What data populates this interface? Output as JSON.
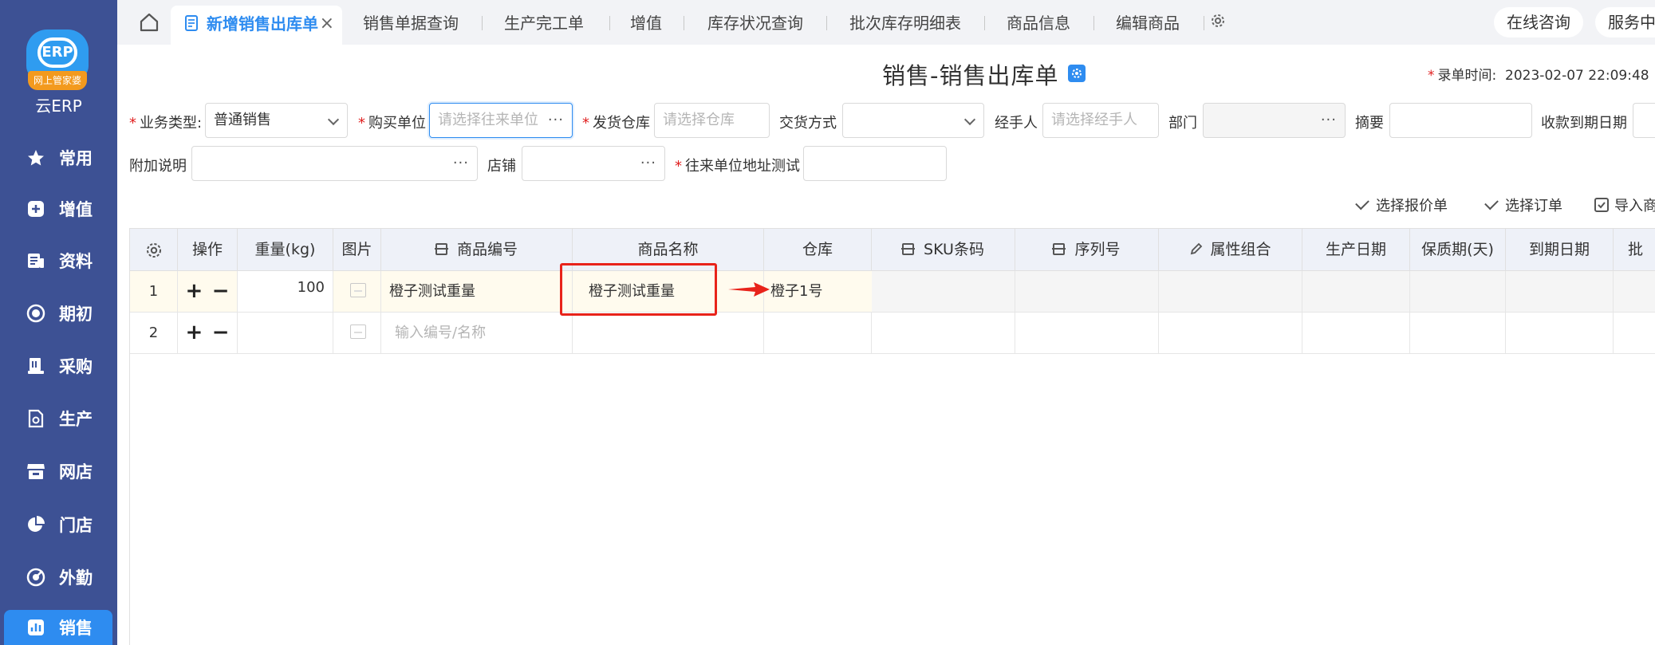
{
  "sidebar": {
    "logo_band": "网上管家婆",
    "logo_mark": "ERP",
    "brand": "云ERP",
    "items": [
      {
        "label": "常用",
        "icon": "star-icon"
      },
      {
        "label": "增值",
        "icon": "plus-square-icon"
      },
      {
        "label": "资料",
        "icon": "document-icon"
      },
      {
        "label": "期初",
        "icon": "target-icon"
      },
      {
        "label": "采购",
        "icon": "purchase-icon"
      },
      {
        "label": "生产",
        "icon": "production-icon"
      },
      {
        "label": "网店",
        "icon": "shop-icon"
      },
      {
        "label": "门店",
        "icon": "pie-icon"
      },
      {
        "label": "外勤",
        "icon": "field-icon"
      },
      {
        "label": "销售",
        "icon": "chart-icon",
        "active": true
      }
    ]
  },
  "tabs": {
    "active": "新增销售出库单",
    "items": [
      "销售单据查询",
      "生产完工单",
      "增值",
      "库存状况查询",
      "批次库存明细表",
      "商品信息",
      "编辑商品"
    ],
    "close_glyph": "×",
    "online_consult": "在线咨询",
    "service": "服务中"
  },
  "page": {
    "title": "销售-销售出库单",
    "entry_time_label": "录单时间:",
    "entry_time_value": "2023-02-07 22:09:48"
  },
  "form": {
    "business_type": {
      "label": "业务类型:",
      "value": "普通销售"
    },
    "buyer": {
      "label": "购买单位",
      "placeholder": "请选择往来单位"
    },
    "warehouse": {
      "label": "发货仓库",
      "placeholder": "请选择仓库"
    },
    "delivery": {
      "label": "交货方式",
      "value": ""
    },
    "handler": {
      "label": "经手人",
      "placeholder": "请选择经手人"
    },
    "department": {
      "label": "部门",
      "value": ""
    },
    "summary": {
      "label": "摘要",
      "value": ""
    },
    "due_date": {
      "label": "收款到期日期",
      "value": ""
    },
    "extra_note": {
      "label": "附加说明",
      "value": ""
    },
    "store": {
      "label": "店铺",
      "value": ""
    },
    "partner_address": {
      "label": "往来单位地址测试",
      "value": ""
    },
    "more_glyph": "···"
  },
  "actions": {
    "select_quote": "选择报价单",
    "select_order": "选择订单",
    "import": "导入商"
  },
  "grid": {
    "columns": [
      "操作",
      "重量(kg)",
      "图片",
      "商品编号",
      "商品名称",
      "仓库",
      "SKU条码",
      "序列号",
      "属性组合",
      "生产日期",
      "保质期(天)",
      "到期日期",
      "批"
    ],
    "rows": [
      {
        "index": "1",
        "plus": "+",
        "minus": "−",
        "weight": "100",
        "code": "橙子测试重量",
        "name": "橙子测试重量",
        "warehouse": "橙子1号"
      },
      {
        "index": "2",
        "plus": "+",
        "minus": "−",
        "code_placeholder": "输入编号/名称"
      }
    ]
  },
  "colors": {
    "sidebar": "#3d5194",
    "accent": "#2e8cf0",
    "highlight_row": "#fffbee",
    "annotation": "#e8231a"
  }
}
